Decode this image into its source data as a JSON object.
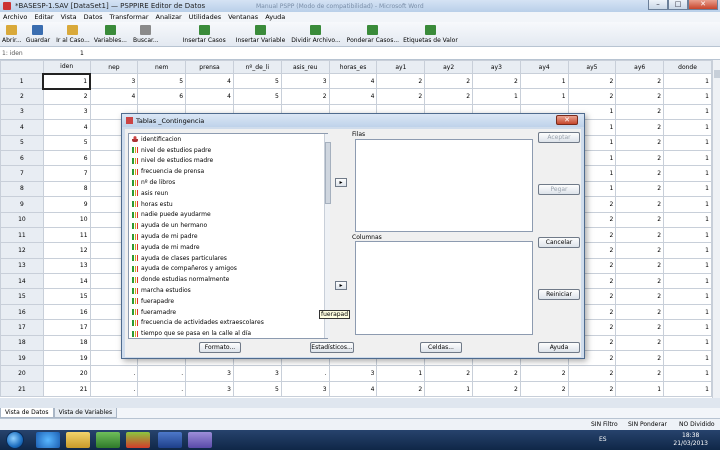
{
  "window": {
    "title": "*BASESP-1.SAV [DataSet1] — PSPPIRE Editor de Datos",
    "ghost_text": "Manual PSPP (Modo de compatibilidad) - Microsoft Word",
    "minimize": "–",
    "maximize": "□",
    "close": "✕"
  },
  "menu": [
    "Archivo",
    "Editar",
    "Vista",
    "Datos",
    "Transformar",
    "Analizar",
    "Utilidades",
    "Ventanas",
    "Ayuda"
  ],
  "toolbar": [
    {
      "label": "Abrir...",
      "color": "#d9a93a"
    },
    {
      "label": "Guardar",
      "color": "#3a6db0"
    },
    {
      "label": "Ir al Caso...",
      "color": "#d9a93a"
    },
    {
      "label": "Variables...",
      "color": "#3a8b3a"
    },
    {
      "label": "Buscar...",
      "color": "#8a8a8a"
    },
    {
      "label": "Insertar Casos",
      "color": "#3a8b3a"
    },
    {
      "label": "Insertar Variable",
      "color": "#3a8b3a"
    },
    {
      "label": "Dividir Archivo...",
      "color": "#3a8b3a"
    },
    {
      "label": "Ponderar Casos...",
      "color": "#3a8b3a"
    },
    {
      "label": "Etiquetas de Valor",
      "color": "#3a8b3a"
    }
  ],
  "refbar": {
    "ref": "1: iden",
    "value": "1"
  },
  "grid": {
    "columns": [
      "iden",
      "nep",
      "nem",
      "prensa",
      "nº_de_li",
      "asis_reu",
      "horas_es",
      "ay1",
      "ay2",
      "ay3",
      "ay4",
      "ay5",
      "ay6",
      "donde"
    ],
    "rows": [
      [
        "1",
        "3",
        "5",
        "4",
        "5",
        "3",
        "4",
        "2",
        "2",
        "2",
        "1",
        "2",
        "2",
        "1"
      ],
      [
        "2",
        "4",
        "6",
        "4",
        "5",
        "2",
        "4",
        "2",
        "2",
        "1",
        "1",
        "2",
        "2",
        "1"
      ],
      [
        "3",
        "",
        "",
        "",
        "",
        "",
        "",
        "",
        "",
        "",
        "",
        "1",
        "2",
        "1"
      ],
      [
        "4",
        "",
        "",
        "",
        "",
        "",
        "",
        "",
        "",
        "",
        "",
        "1",
        "2",
        "1"
      ],
      [
        "5",
        "",
        "",
        "",
        "",
        "",
        "",
        "",
        "",
        "",
        "",
        "1",
        "2",
        "1"
      ],
      [
        "6",
        "",
        "",
        "",
        "",
        "",
        "",
        "",
        "",
        "",
        "",
        "1",
        "2",
        "1"
      ],
      [
        "7",
        "",
        "",
        "",
        "",
        "",
        "",
        "",
        "",
        "",
        "",
        "1",
        "2",
        "1"
      ],
      [
        "8",
        "",
        "",
        "",
        "",
        "",
        "",
        "",
        "",
        "",
        "",
        "1",
        "2",
        "1"
      ],
      [
        "9",
        "",
        "",
        "",
        "",
        "",
        "",
        "",
        "",
        "",
        "",
        "2",
        "2",
        "1"
      ],
      [
        "10",
        "",
        "",
        "",
        "",
        "",
        "",
        "",
        "",
        "",
        "",
        "2",
        "2",
        "1"
      ],
      [
        "11",
        "",
        "",
        "",
        "",
        "",
        "",
        "",
        "",
        "",
        "",
        "2",
        "2",
        "1"
      ],
      [
        "12",
        "",
        "",
        "",
        "",
        "",
        "",
        "",
        "",
        "",
        "",
        "2",
        "2",
        "1"
      ],
      [
        "13",
        "",
        "",
        "",
        "",
        "",
        "",
        "",
        "",
        "",
        "",
        "2",
        "2",
        "1"
      ],
      [
        "14",
        "",
        "",
        "",
        "",
        "",
        "",
        "",
        "",
        "",
        "",
        "2",
        "2",
        "1"
      ],
      [
        "15",
        "",
        "",
        "",
        "",
        "",
        "",
        "",
        "",
        "",
        "",
        "2",
        "2",
        "1"
      ],
      [
        "16",
        "",
        "",
        "",
        "",
        "",
        "",
        "",
        "",
        "",
        "",
        "2",
        "2",
        "1"
      ],
      [
        "17",
        "",
        "",
        "",
        "",
        "",
        "",
        "",
        "",
        "",
        "",
        "2",
        "2",
        "1"
      ],
      [
        "18",
        "",
        "",
        "",
        "",
        "",
        "",
        "",
        "",
        "",
        "",
        "2",
        "2",
        "1"
      ],
      [
        "19",
        "",
        "",
        "",
        "",
        "",
        "",
        "",
        "",
        "",
        "",
        "2",
        "2",
        "1"
      ],
      [
        "20",
        ".",
        ".",
        "3",
        "3",
        ".",
        "3",
        "1",
        "2",
        "2",
        "2",
        "2",
        "2",
        "1"
      ],
      [
        "21",
        ".",
        ".",
        "3",
        "5",
        "3",
        "4",
        "2",
        "1",
        "2",
        "2",
        "2",
        "1",
        "1"
      ]
    ]
  },
  "tabs": [
    "Vista de Datos",
    "Vista de Variables"
  ],
  "status": {
    "filter": "SIN Filtro",
    "weight": "SIN Ponderar",
    "split": "NO Dividido"
  },
  "taskbar": {
    "lang": "ES",
    "time": "18:38",
    "date": "21/03/2013"
  },
  "dialog": {
    "title": "Tablas _Contingencia",
    "close": "✕",
    "variables": [
      "identificacion",
      "nivel de estudios padre",
      "nivel de estudios madre",
      "frecuencia de prensa",
      "nº de libros",
      "asis reun",
      "horas estu",
      "nadie puede ayudarme",
      "ayuda de un hermano",
      "ayuda de mi padre",
      "ayuda de mi madre",
      "ayuda de clases particulares",
      "ayuda de compañeros y amigos",
      "donde estudias normalmente",
      "marcha estudios",
      "fuerapadre",
      "fueramadre",
      "frecuencia de actividades extraescolares",
      "tiempo que se pasa en la calle al día"
    ],
    "rows_label": "Filas",
    "cols_label": "Columnas",
    "move": "▸",
    "tooltip": "fuerapad",
    "buttons": {
      "accept": "Aceptar",
      "paste": "Pegar",
      "cancel": "Cancelar",
      "reset": "Reiniciar",
      "help": "Ayuda",
      "format": "Formato...",
      "stats": "Estadísticos...",
      "cells": "Celdas..."
    }
  }
}
